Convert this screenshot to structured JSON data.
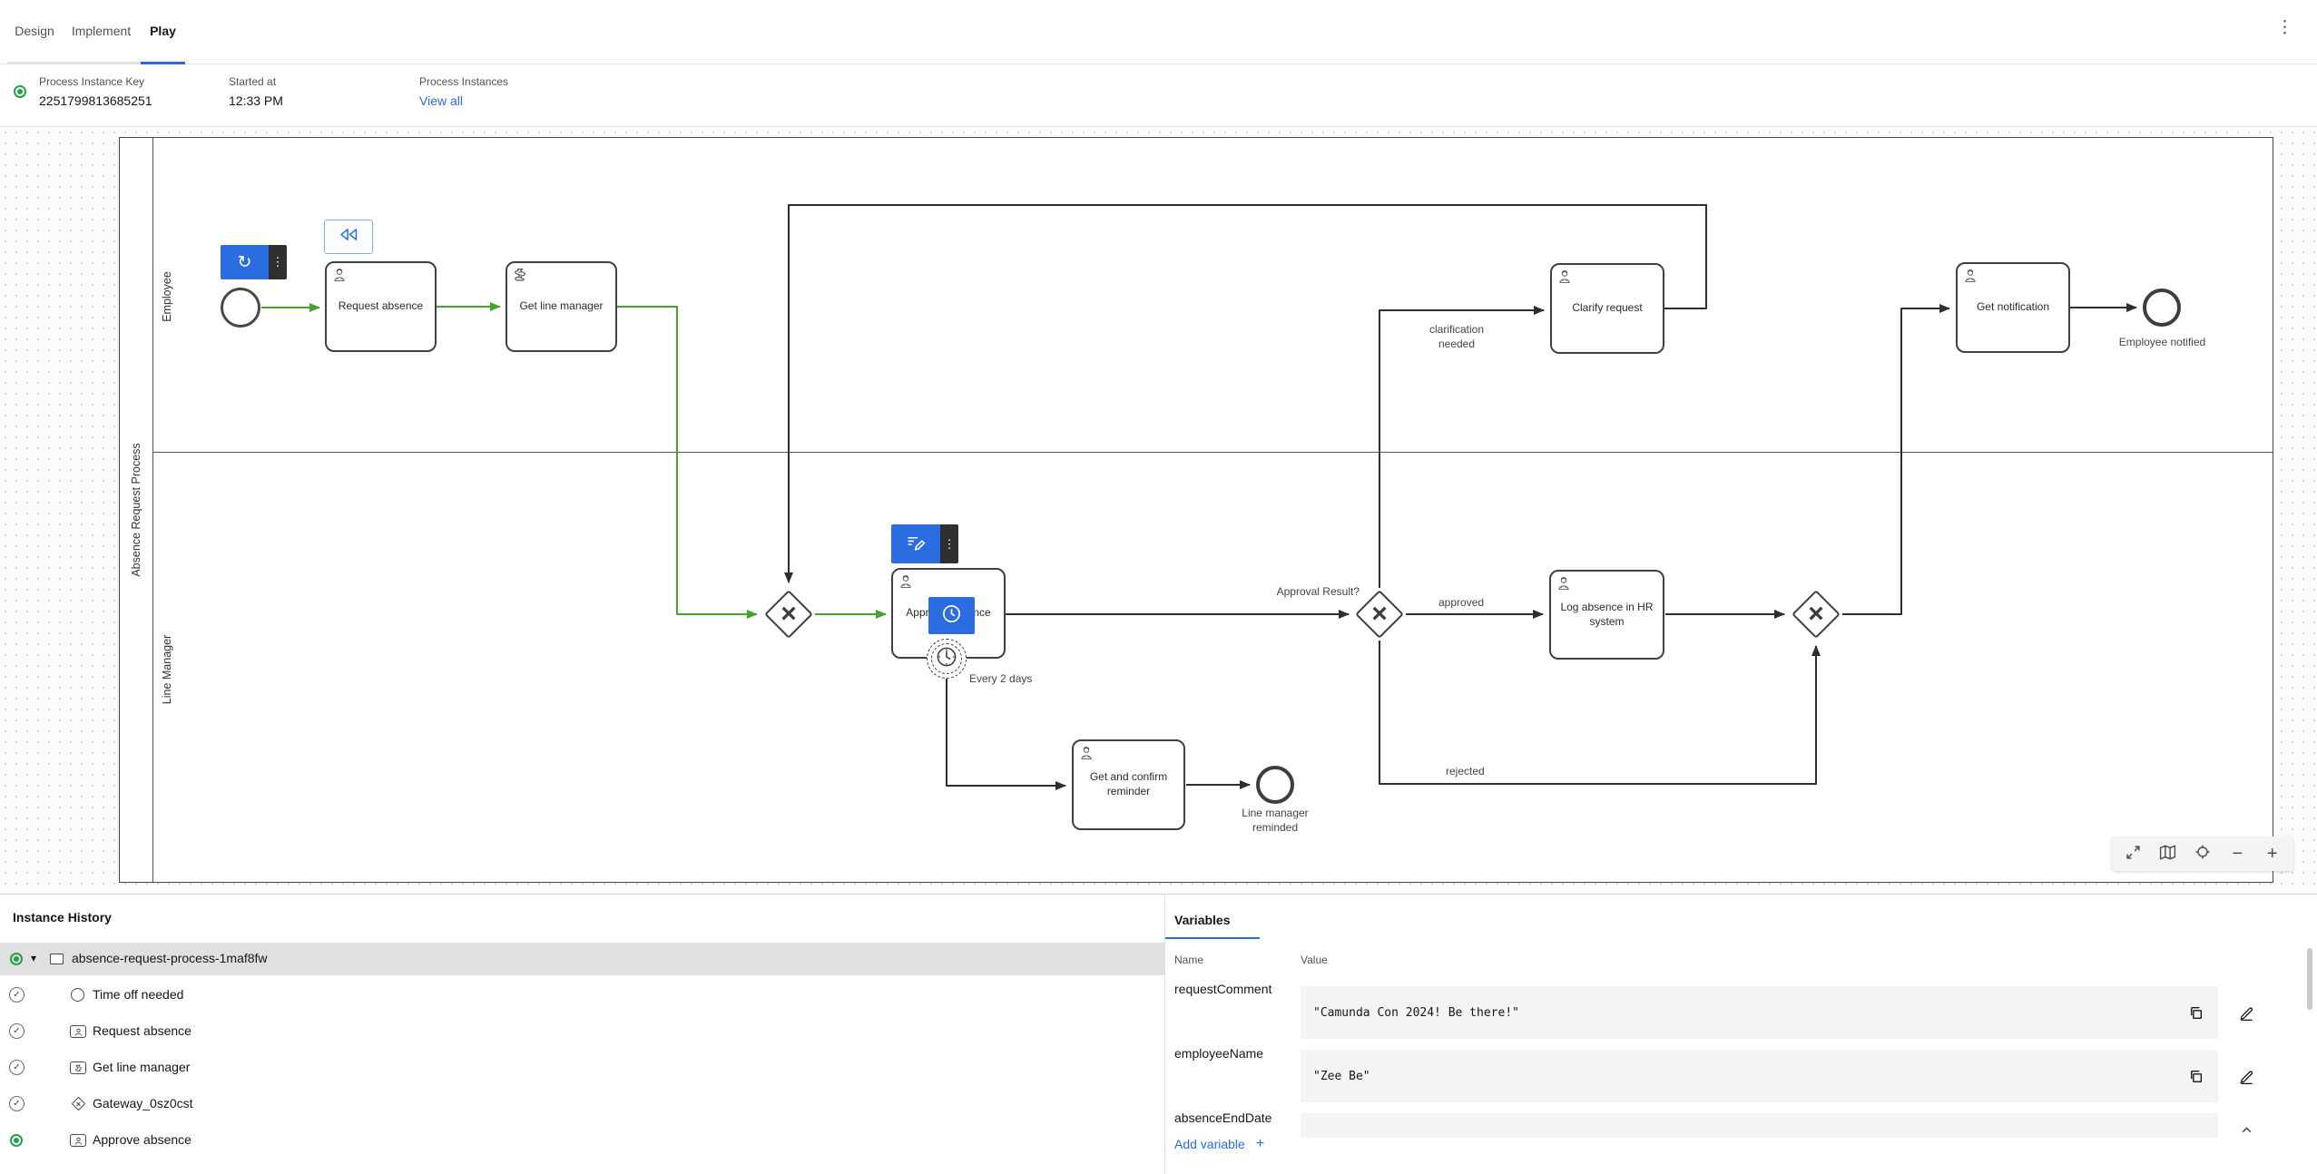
{
  "header": {
    "tabs": [
      "Design",
      "Implement",
      "Play"
    ],
    "active_tab": "Play",
    "instance_bar": {
      "key_label": "Process Instance Key",
      "key_value": "2251799813685251",
      "started_label": "Started at",
      "started_value": "12:33 PM",
      "instances_label": "Process Instances",
      "view_all_label": "View all"
    }
  },
  "icons": {
    "kebab": "⋮",
    "restart": "↻",
    "caret_down": "▾",
    "check": "✓",
    "gateway_marker": "×",
    "zoom_in": "+",
    "zoom_out": "−",
    "add": "+"
  },
  "diagram": {
    "pool_label": "Absence Request Process",
    "lanes": [
      "Employee",
      "Line Manager"
    ],
    "tasks": [
      {
        "id": "request-absence",
        "type": "user-task",
        "label": "Request absence"
      },
      {
        "id": "get-line-manager",
        "type": "script-task",
        "label": "Get line manager"
      },
      {
        "id": "approve-absence",
        "type": "user-task",
        "label": "Approve absence"
      },
      {
        "id": "clarify-request",
        "type": "user-task",
        "label": "Clarify request"
      },
      {
        "id": "log-absence-in-hr-system",
        "type": "user-task",
        "label": "Log absence in HR system"
      },
      {
        "id": "get-notification",
        "type": "user-task",
        "label": "Get notification"
      },
      {
        "id": "get-and-confirm-reminder",
        "type": "user-task",
        "label": "Get and confirm reminder"
      }
    ],
    "event_labels": {
      "employee_notified": "Employee notified",
      "line_manager_reminded": "Line manager reminded"
    },
    "flow_labels": {
      "approval_result": "Approval Result?",
      "approved": "approved",
      "rejected": "rejected",
      "clarification_needed": "clarification needed",
      "every_2_days": "Every 2 days"
    }
  },
  "history": {
    "title": "Instance History",
    "items": [
      {
        "label": "absence-request-process-1maf8fw",
        "type": "process",
        "status": "active",
        "selected": true
      },
      {
        "label": "Time off needed",
        "type": "start-event",
        "status": "completed"
      },
      {
        "label": "Request absence",
        "type": "user-task",
        "status": "completed"
      },
      {
        "label": "Get line manager",
        "type": "script-task",
        "status": "completed"
      },
      {
        "label": "Gateway_0sz0cst",
        "type": "gateway",
        "status": "completed"
      },
      {
        "label": "Approve absence",
        "type": "user-task",
        "status": "active"
      }
    ]
  },
  "variables": {
    "tab_label": "Variables",
    "name_header": "Name",
    "value_header": "Value",
    "rows": [
      {
        "name": "requestComment",
        "value": "\"Camunda Con 2024! Be there!\""
      },
      {
        "name": "employeeName",
        "value": "\"Zee Be\""
      },
      {
        "name": "absenceEndDate",
        "value": ""
      }
    ],
    "add_variable_label": "Add variable"
  },
  "colors": {
    "accent_blue": "#2b6de0",
    "flow_green": "#45a32a",
    "status_green": "#24a148"
  }
}
